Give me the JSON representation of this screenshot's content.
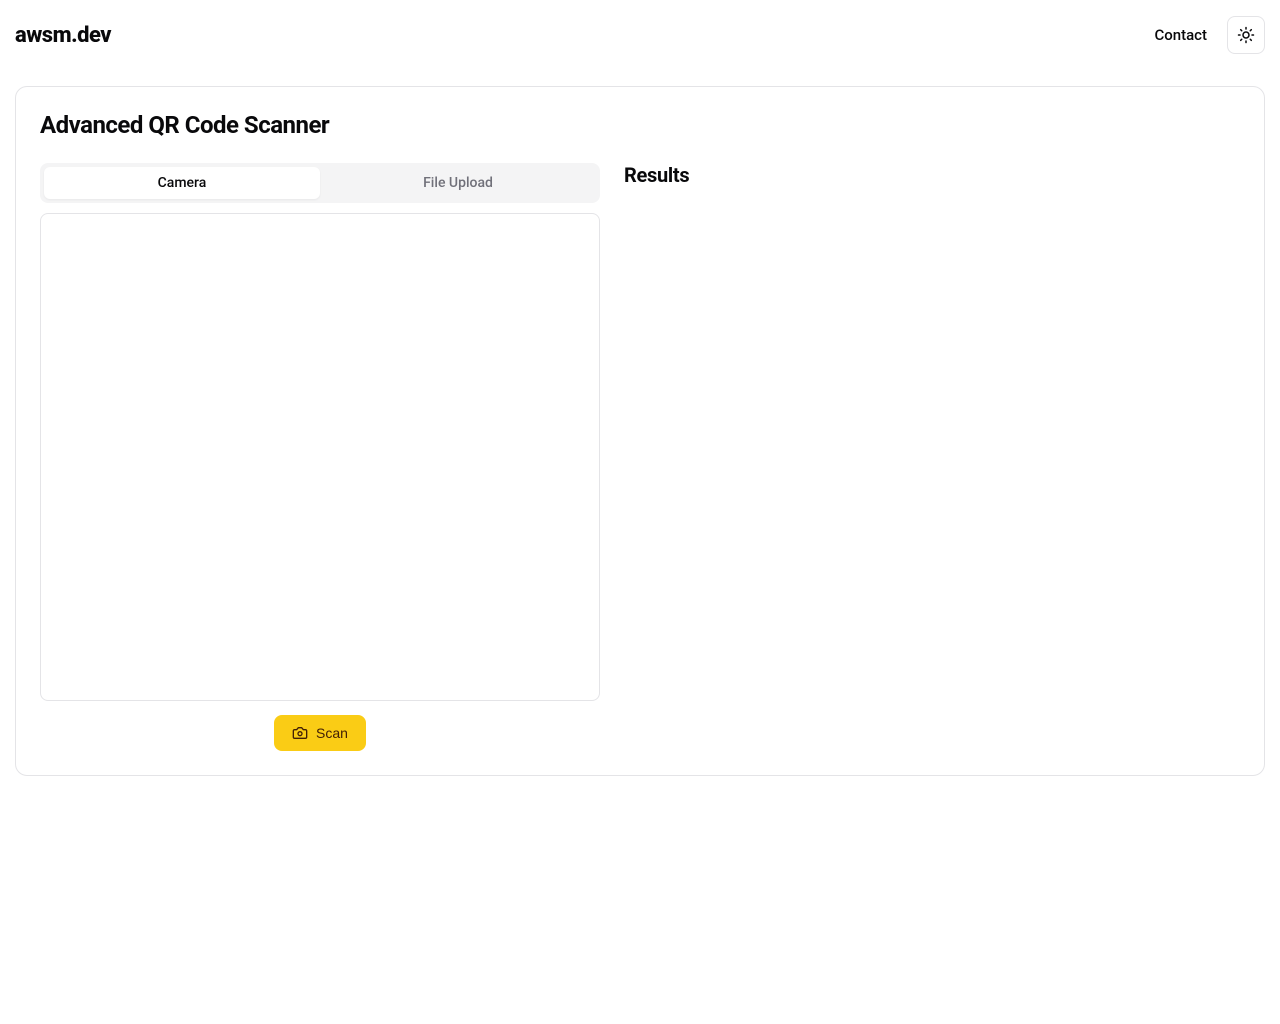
{
  "header": {
    "logo": "awsm.dev",
    "contact": "Contact"
  },
  "card": {
    "title": "Advanced QR Code Scanner"
  },
  "tabs": {
    "camera": "Camera",
    "file_upload": "File Upload"
  },
  "actions": {
    "scan": "Scan"
  },
  "results": {
    "title": "Results"
  }
}
